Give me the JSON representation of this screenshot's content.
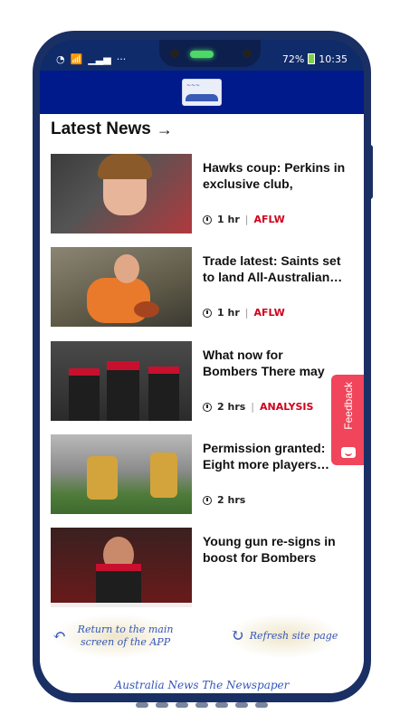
{
  "status_bar": {
    "signal": "📶",
    "extra": "···",
    "battery": "72%",
    "time": "10:35"
  },
  "section": {
    "title": "Latest News",
    "arrow": "→"
  },
  "news": [
    {
      "headline": "Hawks coup: Perkins in exclusive club, Giants…",
      "time": "1 hr",
      "tag": "AFLW",
      "colors": [
        "#b03a3e",
        "#2d2d2d"
      ]
    },
    {
      "headline": "Trade latest: Saints set to land All-Australian…",
      "time": "1 hr",
      "tag": "AFLW",
      "colors": [
        "#e9792b",
        "#8a7e5e"
      ]
    },
    {
      "headline": "What now for Bombers There may be worse t…",
      "time": "2 hrs",
      "tag": "ANALYSIS",
      "colors": [
        "#1e1e1e",
        "#c8102e"
      ]
    },
    {
      "headline": "Permission granted: Eight more players…",
      "time": "2 hrs",
      "tag": "",
      "colors": [
        "#7d4a1f",
        "#4f7c3a"
      ]
    },
    {
      "headline": "Young gun re-signs in boost for Bombers",
      "time": "",
      "tag": "",
      "colors": [
        "#2a1d1d",
        "#c8102e"
      ]
    }
  ],
  "feedback": {
    "label": "Feedback"
  },
  "bottom": {
    "return_label": "Return to the main screen of the APP",
    "refresh_label": "Refresh site page",
    "brand": "Australia News The Newspaper"
  },
  "colors": {
    "app_header": "#001a8c",
    "tag": "#d0021b",
    "feedback": "#f0455a"
  }
}
